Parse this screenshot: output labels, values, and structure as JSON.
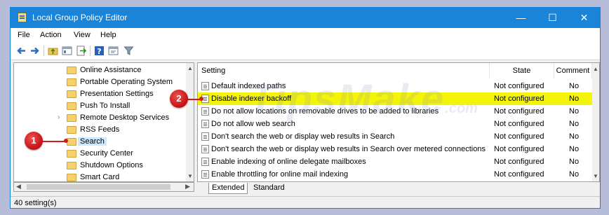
{
  "window": {
    "title": "Local Group Policy Editor"
  },
  "controls": {
    "minimize": "—",
    "maximize": "☐",
    "close": "✕"
  },
  "menu": [
    "File",
    "Action",
    "View",
    "Help"
  ],
  "toolbar": [
    "back-icon",
    "forward-icon",
    "up-folder-icon",
    "show-hide-tree-icon",
    "export-icon",
    "help-icon",
    "properties-icon",
    "filter-icon"
  ],
  "tree": {
    "items": [
      "Online Assistance",
      "Portable Operating System",
      "Presentation Settings",
      "Push To Install",
      "Remote Desktop Services",
      "RSS Feeds",
      "Search",
      "Security Center",
      "Shutdown Options",
      "Smart Card"
    ],
    "selected": "Search"
  },
  "list": {
    "columns": [
      "Setting",
      "State",
      "Comment"
    ],
    "rows": [
      {
        "setting": "Default indexed paths",
        "state": "Not configured",
        "comment": "No"
      },
      {
        "setting": "Disable indexer backoff",
        "state": "Not configured",
        "comment": "No"
      },
      {
        "setting": "Do not allow locations on removable drives to be added to libraries",
        "state": "Not configured",
        "comment": "No"
      },
      {
        "setting": "Do not allow web search",
        "state": "Not configured",
        "comment": "No"
      },
      {
        "setting": "Don't search the web or display web results in Search",
        "state": "Not configured",
        "comment": "No"
      },
      {
        "setting": "Don't search the web or display web results in Search over metered connections",
        "state": "Not configured",
        "comment": "No"
      },
      {
        "setting": "Enable indexing of online delegate mailboxes",
        "state": "Not configured",
        "comment": "No"
      },
      {
        "setting": "Enable throttling for online mail indexing",
        "state": "Not configured",
        "comment": "No"
      }
    ],
    "highlight_color": "#f4f40a"
  },
  "tabs": [
    "Extended",
    "Standard"
  ],
  "status": "40 setting(s)",
  "annotations": {
    "badge1": "1",
    "badge2": "2"
  },
  "watermark": {
    "main": "TipsMake",
    "suffix": ".com"
  }
}
